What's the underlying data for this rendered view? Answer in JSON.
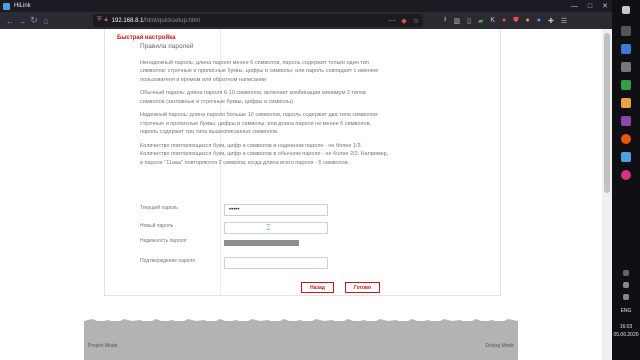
{
  "browser": {
    "tab_title": "HiLink",
    "url_host": "192.168.8.1",
    "url_path": "/html/quicksetup.html",
    "window_controls": {
      "minimize": "—",
      "maximize": "□",
      "close": "✕"
    },
    "nav_icons": [
      "back-icon",
      "forward-icon",
      "reload-icon",
      "home-icon"
    ]
  },
  "sidebar": {
    "title": "Быстрая настройка"
  },
  "rules": {
    "heading": "Правила паролей",
    "paragraphs": [
      "Ненадежный пароль: длина пароля менее 6 символов, пароль содержит только один тип символов: строчные и прописные буквы, цифры и символы; или пароль совпадает с именем пользователя в прямом или обратном написании",
      "Обычный пароль: длина пароля 6-10 символов, включает комбинации минимум 2 типов символов (заглавные и строчные буквы, цифры и символы)",
      "Надежный пароль: длина пароля больше 10 символов, пароль содержит два типа символов: строчные и прописные буквы, цифры и символы; или длина пароля не менее 6 символов, пароль содержит три типа вышеописанных символов.",
      "Количество повторяющихся букв, цифр и символов в надежном пароле - не более 1/3. Количество повторяющихся букв, цифр и символов в обычном пароле - не более 2/3. Например, в пароле \"11aaa\" повторяются 2 символа, когда длина всего пароля - 5 символов."
    ]
  },
  "form": {
    "current_password_label": "Текущий пароль",
    "current_password_value": "•••••",
    "new_password_label": "Новый пароль",
    "new_password_value": "",
    "strength_label": "Надежность пароля",
    "confirm_password_label": "Подтверждение пароля",
    "confirm_password_value": ""
  },
  "buttons": {
    "back": "Назад",
    "done": "Готово"
  },
  "footer": {
    "left": "Project Mode",
    "right": "Debug Mode"
  },
  "taskbar": {
    "language": "ENG",
    "time": "16:03",
    "date": "05.06.2020"
  }
}
